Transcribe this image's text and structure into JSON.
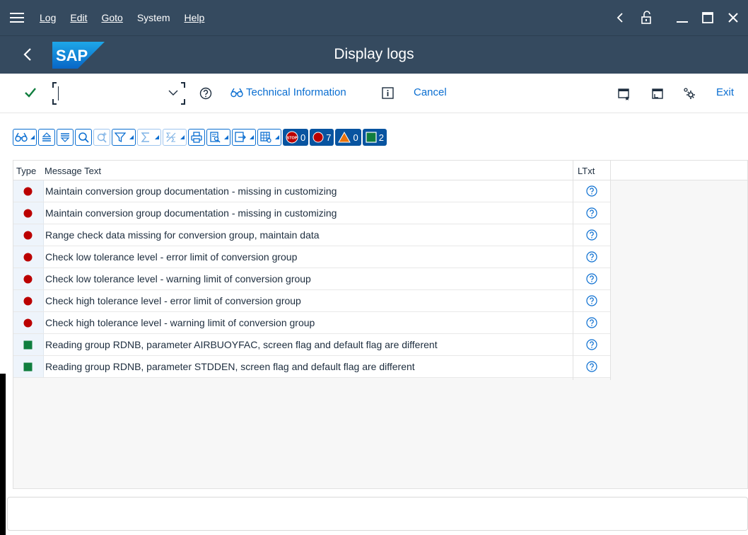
{
  "menubar": {
    "items": [
      {
        "label": "Log"
      },
      {
        "label": "Edit"
      },
      {
        "label": "Goto"
      },
      {
        "label": "System"
      },
      {
        "label": "Help"
      }
    ]
  },
  "titlebar": {
    "logo_text": "SAP",
    "title": "Display logs"
  },
  "toolbar": {
    "command_value": "",
    "technical_info_label": "Technical Information",
    "cancel_label": "Cancel",
    "exit_label": "Exit"
  },
  "alv_counts": {
    "stop": "0",
    "error": "7",
    "warning": "0",
    "success": "2"
  },
  "grid": {
    "headers": {
      "type": "Type",
      "message": "Message Text",
      "ltxt": "LTxt"
    },
    "rows": [
      {
        "status": "error",
        "message": "Maintain conversion group documentation - missing in customizing"
      },
      {
        "status": "error",
        "message": "Maintain conversion group documentation - missing in customizing"
      },
      {
        "status": "error",
        "message": "Range check data missing for conversion group, maintain data"
      },
      {
        "status": "error",
        "message": "Check low tolerance level - error limit of conversion group"
      },
      {
        "status": "error",
        "message": "Check low tolerance level - warning limit of conversion group"
      },
      {
        "status": "error",
        "message": "Check high tolerance level - error limit of conversion group"
      },
      {
        "status": "error",
        "message": "Check high tolerance level - warning limit of conversion group"
      },
      {
        "status": "success",
        "message": "Reading group RDNB, parameter AIRBUOYFAC, screen flag and default flag are different"
      },
      {
        "status": "success",
        "message": "Reading group RDNB, parameter STDDEN, screen flag and default flag are different"
      }
    ]
  },
  "colors": {
    "shell": "#354a5f",
    "accent": "#0a6ed1",
    "error": "#bb0000",
    "success": "#107e3e",
    "warning": "#e9730c"
  }
}
